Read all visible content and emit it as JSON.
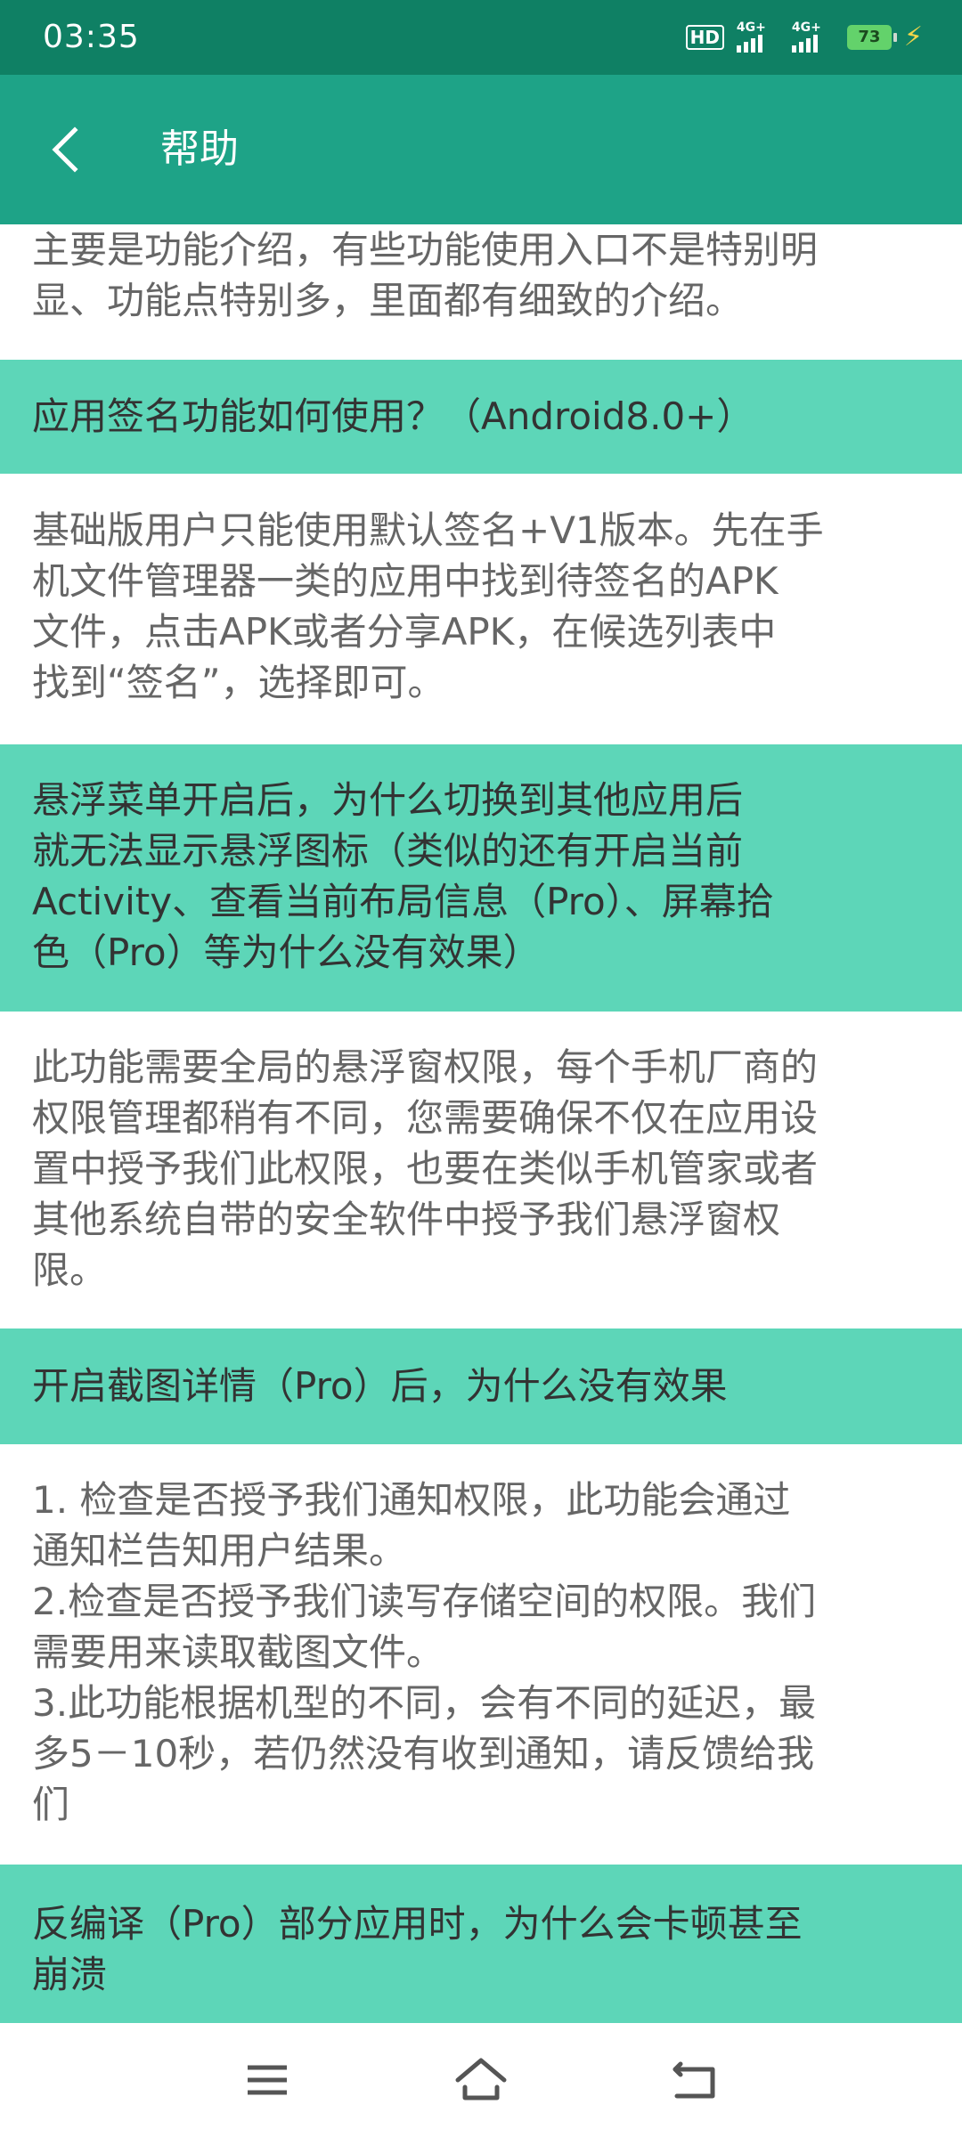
{
  "status_bar": {
    "time": "03:35",
    "hd_label": "HD",
    "network_1": "4G+",
    "network_2": "4G+",
    "battery": "73"
  },
  "app_bar": {
    "title": "帮助",
    "back_icon": "chevron-left-icon"
  },
  "help_items": {
    "intro_answer": "主要是功能介绍，有些功能使用入口不是特别明\n显、功能点特别多，里面都有细致的介绍。",
    "q1": "应用签名功能如何使用？（Android8.0+）",
    "a1": "基础版用户只能使用默认签名+V1版本。先在手\n机文件管理器一类的应用中找到待签名的APK\n文件，点击APK或者分享APK，在候选列表中\n找到“签名”，选择即可。",
    "q2": "悬浮菜单开启后，为什么切换到其他应用后\n就无法显示悬浮图标（类似的还有开启当前\nActivity、查看当前布局信息（Pro）、屏幕拾\n色（Pro）等为什么没有效果）",
    "a2": "此功能需要全局的悬浮窗权限，每个手机厂商的\n权限管理都稍有不同，您需要确保不仅在应用设\n置中授予我们此权限，也要在类似手机管家或者\n其他系统自带的安全软件中授予我们悬浮窗权\n限。",
    "q3": "开启截图详情（Pro）后，为什么没有效果",
    "a3": "1. 检查是否授予我们通知权限，此功能会通过\n通知栏告知用户结果。\n2.检查是否授予我们读写存储空间的权限。我们\n需要用来读取截图文件。\n3.此功能根据机型的不同，会有不同的延迟，最\n多5－10秒，若仍然没有收到通知，请反馈给我\n们",
    "q4": "反编译（Pro）部分应用时，为什么会卡顿甚至\n崩溃"
  },
  "nav_bar": {
    "menu_icon": "menu-icon",
    "home_icon": "home-icon",
    "back_icon": "back-icon"
  },
  "colors": {
    "status_bar": "#0f8064",
    "app_bar": "#1ea387",
    "question_bg": "#5dd6b8",
    "answer_text": "#666666",
    "question_text": "#333333"
  }
}
